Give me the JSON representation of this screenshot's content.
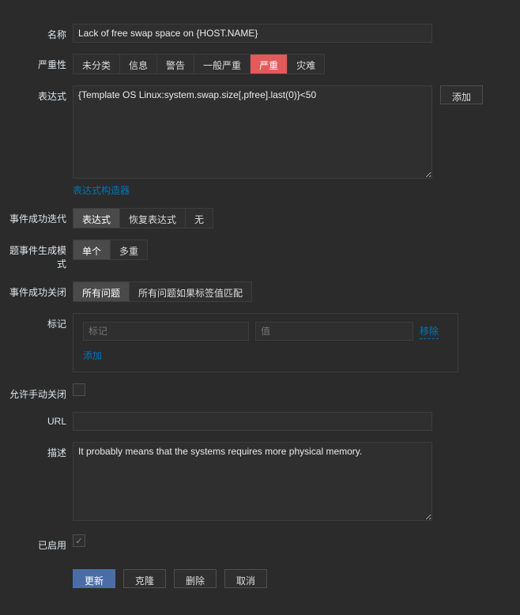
{
  "labels": {
    "name": "名称",
    "severity": "严重性",
    "expression": "表达式",
    "event_iteration": "事件成功迭代",
    "event_generation": "题事件生成模式",
    "event_close": "事件成功关闭",
    "tags": "标记",
    "allow_manual_close": "允许手动关闭",
    "url": "URL",
    "description": "描述",
    "enabled": "已启用"
  },
  "name_value": "Lack of free swap space on {HOST.NAME}",
  "severity_options": [
    "未分类",
    "信息",
    "警告",
    "一般严重",
    "严重",
    "灾难"
  ],
  "severity_selected_index": 4,
  "expression_value": "{Template OS Linux:system.swap.size[,pfree].last(0)}<50",
  "expression_add": "添加",
  "expression_builder": "表达式构造器",
  "iteration_options": [
    "表达式",
    "恢复表达式",
    "无"
  ],
  "iteration_selected_index": 0,
  "generation_options": [
    "单个",
    "多重"
  ],
  "generation_selected_index": 0,
  "close_options": [
    "所有问题",
    "所有问题如果标签值匹配"
  ],
  "close_selected_index": 0,
  "tags": {
    "name_placeholder": "标记",
    "value_placeholder": "值",
    "remove": "移除",
    "add": "添加"
  },
  "allow_manual_close": false,
  "url_value": "",
  "description_value": "It probably means that the systems requires more physical memory.",
  "enabled": true,
  "actions": {
    "update": "更新",
    "clone": "克隆",
    "delete": "删除",
    "cancel": "取消"
  }
}
